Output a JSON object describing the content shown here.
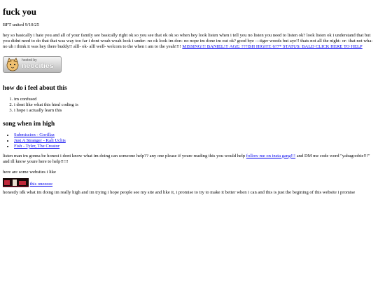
{
  "page": {
    "title": "fuck you",
    "subtitle": "BFT united 9/10/25",
    "intro_text": "hey so basically i hate you and all of your family see basically right ok so you see that ok ok so when hey look listen when i tell you no listen you need to listen ok? look listen ok i understand that but you didnt need to do that that was way too far i dont woah woah look i under- no ok look im don- no nope im done im out ok? good bye ---tiger woods but aye!! thats not all the night- or- that not wha- no uh i think it was hey there buddy!! alll- ok- alll well- welcom to the when i am to the yeah!!!! ",
    "intro_link": "MISSING!!! BANIEL!!! AGE: ???ISH HIGHT: 6?7* STATUS: BALD CLICK HERE TO HELP"
  },
  "badge": {
    "hosted_by": "hosted by",
    "brand": "neocities",
    "icon": "neocities-cat-icon"
  },
  "feelings": {
    "heading": "how do i feel about this",
    "items": [
      "im confused",
      "i dont like what this html coding is",
      "i hope i actually learn this"
    ]
  },
  "songs": {
    "heading": "song when im high",
    "items": [
      "Submission - Gorillaz",
      "Just A Stranger - Kali Uchis",
      "Fish - Tyler, The Creator"
    ]
  },
  "help": {
    "text_before": "listen man im gonna be honest i dont know what im doing can someone help?? any one please if youre reading this you would help ",
    "link": "follow me on insta gang!!!",
    "text_after": " and DM me code word \"yabagoobie!!!\" and ill know youre here to help!!!!!"
  },
  "websites": {
    "intro": "here are some websites i like",
    "link": "this oneeeee"
  },
  "closing": {
    "text": "honestly idk what im doing im really high and im trying i hope people see my site and like it, i promise to try to make it better when i can and this is just the begining of this website i promise"
  },
  "colors": {
    "link": "#0000ee",
    "text": "#000000",
    "background": "#ffffff"
  }
}
